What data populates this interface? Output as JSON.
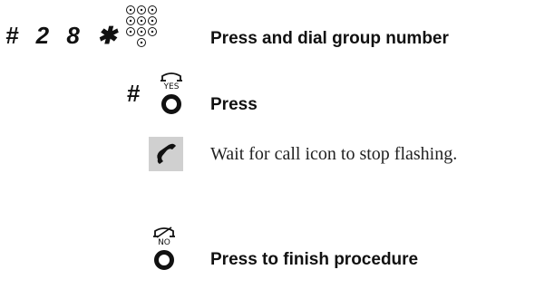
{
  "step1": {
    "code": "# 2 8 ✱",
    "label": "Press and dial group number",
    "keypad_icon": "keypad-icon"
  },
  "step2": {
    "hash": "#",
    "key_label": "YES",
    "label": "Press",
    "icon": "yes-key-icon"
  },
  "step3": {
    "label": "Wait for call icon to stop flashing.",
    "icon": "handset-call-icon"
  },
  "step4": {
    "key_label": "NO",
    "label": "Press to finish procedure",
    "icon": "no-key-icon"
  }
}
